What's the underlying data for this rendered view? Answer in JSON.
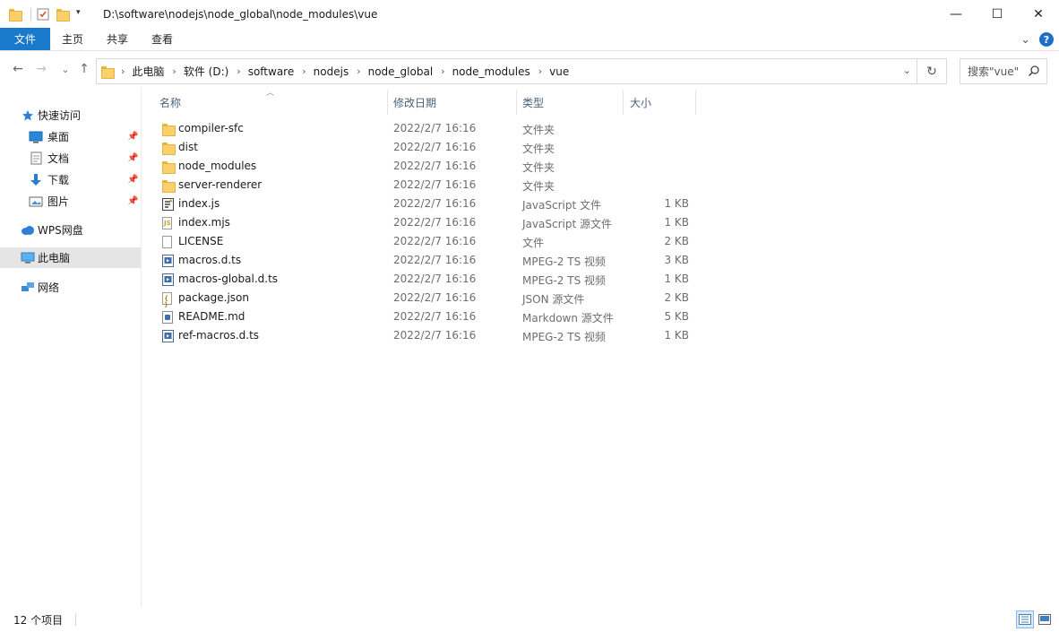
{
  "window": {
    "title_path": "D:\\software\\nodejs\\node_global\\node_modules\\vue",
    "minimize": "—",
    "maximize": "☐",
    "close": "✕"
  },
  "ribbon": {
    "tabs": [
      "文件",
      "主页",
      "共享",
      "查看"
    ],
    "expand": "⌄",
    "help": "?"
  },
  "nav": {
    "back": "←",
    "forward": "→",
    "recent": "⌄",
    "up": "↑"
  },
  "address": {
    "crumbs": [
      "此电脑",
      "软件 (D:)",
      "software",
      "nodejs",
      "node_global",
      "node_modules",
      "vue"
    ],
    "dropdown": "⌄",
    "refresh": "↻"
  },
  "search": {
    "placeholder": "搜索\"vue\""
  },
  "sidebar": {
    "quick_access": "快速访问",
    "items": [
      {
        "label": "桌面",
        "icon": "desktop-icon",
        "pinned": true
      },
      {
        "label": "文档",
        "icon": "documents-icon",
        "pinned": true
      },
      {
        "label": "下载",
        "icon": "download-icon",
        "pinned": true
      },
      {
        "label": "图片",
        "icon": "pictures-icon",
        "pinned": true
      }
    ],
    "wps": "WPS网盘",
    "this_pc": "此电脑",
    "network": "网络"
  },
  "columns": {
    "name": "名称",
    "date": "修改日期",
    "type": "类型",
    "size": "大小"
  },
  "files": [
    {
      "name": "compiler-sfc",
      "date": "2022/2/7 16:16",
      "type": "文件夹",
      "size": "",
      "icon": "folder-icon"
    },
    {
      "name": "dist",
      "date": "2022/2/7 16:16",
      "type": "文件夹",
      "size": "",
      "icon": "folder-icon"
    },
    {
      "name": "node_modules",
      "date": "2022/2/7 16:16",
      "type": "文件夹",
      "size": "",
      "icon": "folder-icon"
    },
    {
      "name": "server-renderer",
      "date": "2022/2/7 16:16",
      "type": "文件夹",
      "size": "",
      "icon": "folder-icon"
    },
    {
      "name": "index.js",
      "date": "2022/2/7 16:16",
      "type": "JavaScript 文件",
      "size": "1 KB",
      "icon": "js-file-icon"
    },
    {
      "name": "index.mjs",
      "date": "2022/2/7 16:16",
      "type": "JavaScript 源文件",
      "size": "1 KB",
      "icon": "mjs-file-icon"
    },
    {
      "name": "LICENSE",
      "date": "2022/2/7 16:16",
      "type": "文件",
      "size": "2 KB",
      "icon": "blank-file-icon"
    },
    {
      "name": "macros.d.ts",
      "date": "2022/2/7 16:16",
      "type": "MPEG-2 TS 视频",
      "size": "3 KB",
      "icon": "ts-video-file-icon"
    },
    {
      "name": "macros-global.d.ts",
      "date": "2022/2/7 16:16",
      "type": "MPEG-2 TS 视频",
      "size": "1 KB",
      "icon": "ts-video-file-icon"
    },
    {
      "name": "package.json",
      "date": "2022/2/7 16:16",
      "type": "JSON 源文件",
      "size": "2 KB",
      "icon": "json-file-icon"
    },
    {
      "name": "README.md",
      "date": "2022/2/7 16:16",
      "type": "Markdown 源文件",
      "size": "5 KB",
      "icon": "markdown-file-icon"
    },
    {
      "name": "ref-macros.d.ts",
      "date": "2022/2/7 16:16",
      "type": "MPEG-2 TS 视频",
      "size": "1 KB",
      "icon": "ts-video-file-icon"
    }
  ],
  "status": {
    "count": "12 个项目"
  },
  "colors": {
    "accent": "#1979ca",
    "selected_nav": "#e5e5e5",
    "header_text": "#4c607a",
    "meta_text": "#6d6d6d"
  }
}
